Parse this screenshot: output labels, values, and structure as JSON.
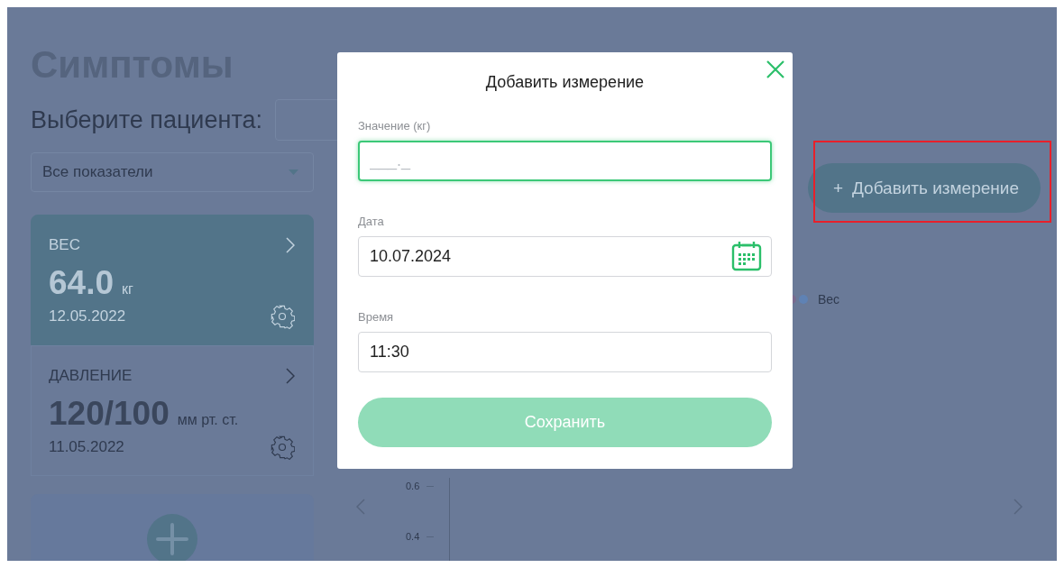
{
  "page": {
    "title": "Симптомы",
    "patient_label": "Выберите пациента:",
    "filter": {
      "value": "Все показатели"
    }
  },
  "metrics": [
    {
      "name": "ВЕС",
      "value": "64.0",
      "unit": "кг",
      "date": "12.05.2022",
      "selected": true
    },
    {
      "name": "ДАВЛЕНИЕ",
      "value": "120/100",
      "unit": "мм рт. ст.",
      "date": "11.05.2022",
      "selected": false
    }
  ],
  "add_button": {
    "icon": "+",
    "label": "Добавить измерение",
    "highlighted": true
  },
  "chart": {
    "legend": {
      "label": "Вес",
      "markers": [
        {
          "color": "#7a6b8f"
        },
        {
          "color": "#5f82b4"
        }
      ]
    },
    "yticks": [
      "0.6",
      "0.4"
    ]
  },
  "modal": {
    "title": "Добавить измерение",
    "fields": [
      {
        "kind": "number",
        "label": "Значение (кг)",
        "placeholder": "___._",
        "focused": true
      },
      {
        "kind": "date",
        "label": "Дата",
        "value": "10.07.2024",
        "focused": false
      },
      {
        "kind": "time",
        "label": "Время",
        "value": "11:30",
        "focused": false
      }
    ],
    "save_button": {
      "label": "Сохранить",
      "disabled": true
    }
  }
}
